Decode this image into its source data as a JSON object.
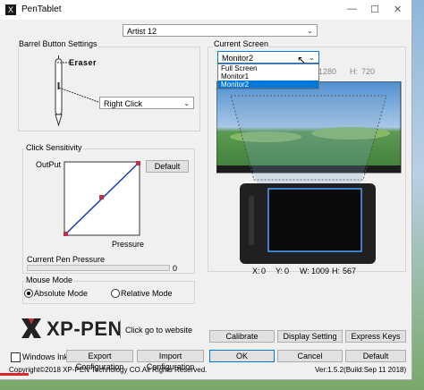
{
  "window": {
    "title": "PenTablet",
    "app_icon_glyph": "X",
    "minimize_glyph": "—",
    "maximize_glyph": "☐",
    "close_glyph": "✕"
  },
  "device": {
    "selected": "Artist 12"
  },
  "barrel": {
    "group_label": "Barrel Button Settings",
    "eraser_label": "Eraser",
    "button_function": "Right Click"
  },
  "click_sensitivity": {
    "group_label": "Click Sensitivity",
    "y_label": "OutPut",
    "x_label": "Pressure",
    "default_button": "Default"
  },
  "pen_pressure": {
    "label": "Current Pen Pressure",
    "value": "0",
    "level": 0
  },
  "mouse_mode": {
    "group_label": "Mouse Mode",
    "absolute_label": "Absolute Mode",
    "relative_label": "Relative Mode",
    "selected": "absolute"
  },
  "current_screen": {
    "group_label": "Current Screen",
    "selected": "Monitor2",
    "options": [
      "Full Screen",
      "Monitor1",
      "Monitor2"
    ],
    "width_value": "1280",
    "height_label": "H:",
    "height_value": "720"
  },
  "area": {
    "x_label": "X:",
    "x_value": "0",
    "y_label": "Y:",
    "y_value": "0",
    "w_label": "W:",
    "w_value": "1009",
    "h_label": "H:",
    "h_value": "567"
  },
  "brand": {
    "name": "XP-PEN",
    "website_link": "Click go to website"
  },
  "bottom": {
    "windows_ink": "Windows Ink",
    "export": "Export Configuration",
    "import": "Import Configuration",
    "calibrate": "Calibrate",
    "display_setting": "Display Setting",
    "express_keys": "Express Keys",
    "ok": "OK",
    "cancel": "Cancel",
    "default": "Default",
    "copyright": "Copyright©2018 XP-PEN Technology CO.All Rights Reserved.",
    "version": "Ver:1.5.2(Build:Sep 11 2018)"
  },
  "colors": {
    "accent": "#0078d7",
    "brand_red": "#d92b2b",
    "curve": "#1a3fb0"
  }
}
